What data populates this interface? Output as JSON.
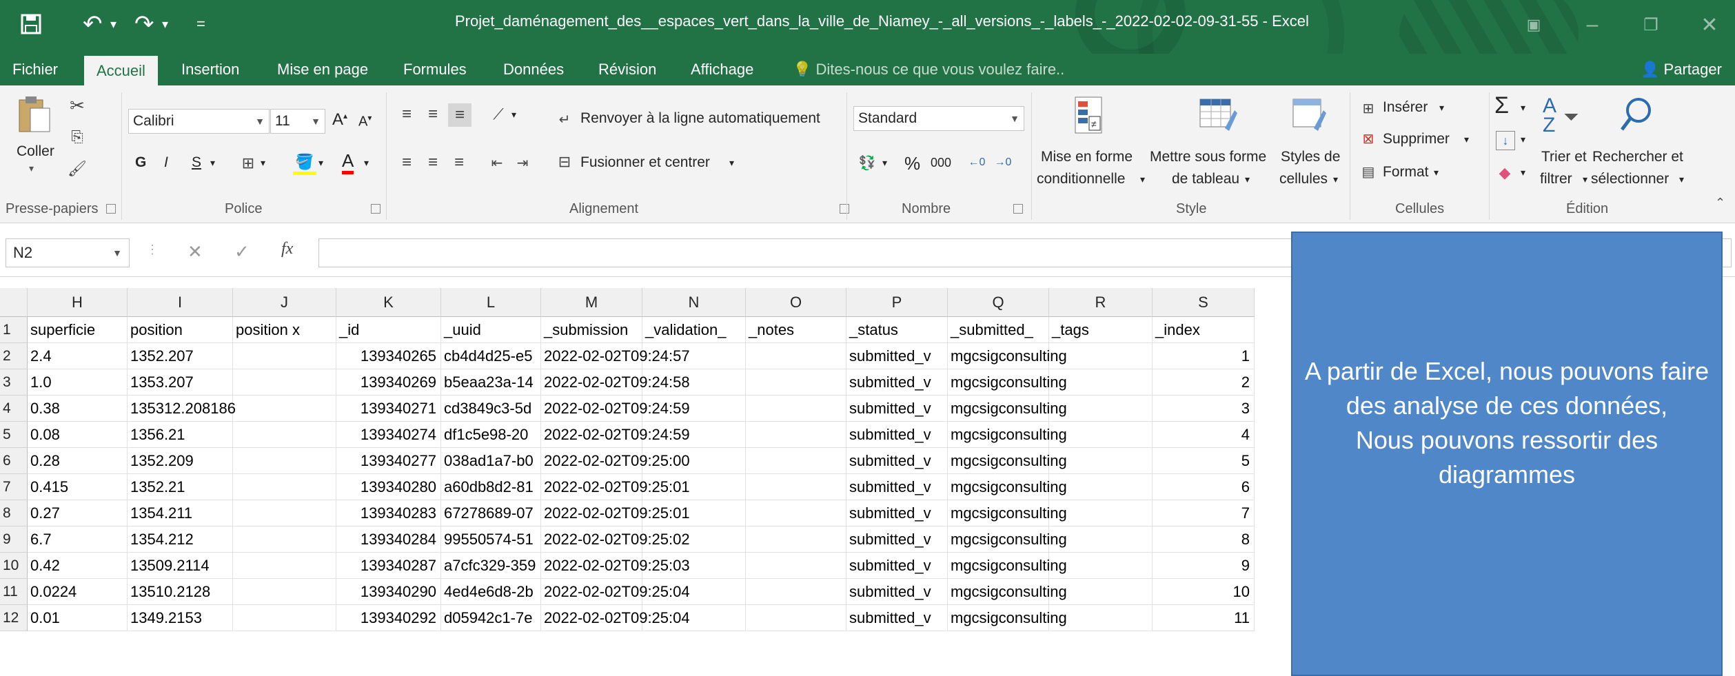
{
  "window": {
    "title": "Projet_daménagement_des__espaces_vert_dans_la_ville_de_Niamey_-_all_versions_-_labels_-_2022-02-02-09-31-55 - Excel"
  },
  "menu": {
    "tabs": [
      "Fichier",
      "Accueil",
      "Insertion",
      "Mise en page",
      "Formules",
      "Données",
      "Révision",
      "Affichage"
    ],
    "tell_me": "Dites-nous ce que vous voulez faire..",
    "share": "Partager"
  },
  "ribbon": {
    "clipboard": {
      "paste": "Coller",
      "label": "Presse-papiers"
    },
    "font": {
      "name": "Calibri",
      "size": "11",
      "bold": "G",
      "italic": "I",
      "underline": "S",
      "label": "Police"
    },
    "alignment": {
      "wrap": "Renvoyer à la ligne automatiquement",
      "merge": "Fusionner et centrer",
      "label": "Alignement"
    },
    "number": {
      "format": "Standard",
      "percent": "%",
      "thousands": "000",
      "label": "Nombre"
    },
    "style": {
      "conditional_1": "Mise en forme",
      "conditional_2": "conditionnelle",
      "table_1": "Mettre sous forme",
      "table_2": "de tableau",
      "cell_1": "Styles de",
      "cell_2": "cellules",
      "label": "Style"
    },
    "cells": {
      "insert": "Insérer",
      "delete": "Supprimer",
      "format": "Format",
      "label": "Cellules"
    },
    "editing": {
      "sort_1": "Trier et",
      "sort_2": "filtrer",
      "find_1": "Rechercher et",
      "find_2": "sélectionner",
      "label": "Édition"
    }
  },
  "formula_bar": {
    "name_box": "N2",
    "fx": "fx"
  },
  "sheet": {
    "columns": [
      "H",
      "I",
      "J",
      "K",
      "L",
      "M",
      "N",
      "O",
      "P",
      "Q",
      "R",
      "S"
    ],
    "header_row": [
      "superficie",
      "position",
      "position x",
      "_id",
      "_uuid",
      "_submission",
      "_validation_",
      "_notes",
      "_status",
      "_submitted_",
      "_tags",
      "_index"
    ],
    "row_numbers": [
      "1",
      "2",
      "3",
      "4",
      "5",
      "6",
      "7",
      "8",
      "9",
      "10",
      "11",
      "12"
    ],
    "rows": [
      {
        "superficie": "2.4",
        "position": "1352.207",
        "id": "139340265",
        "uuid": "cb4d4d25-e5",
        "submission": "2022-02-02T09:24:57",
        "status": "submitted_v",
        "submitted": "mgcsigconsulting",
        "index": "1"
      },
      {
        "superficie": "1.0",
        "position": "1353.207",
        "id": "139340269",
        "uuid": "b5eaa23a-14",
        "submission": "2022-02-02T09:24:58",
        "status": "submitted_v",
        "submitted": "mgcsigconsulting",
        "index": "2"
      },
      {
        "superficie": "0.38",
        "position": "135312.208186",
        "id": "139340271",
        "uuid": "cd3849c3-5d",
        "submission": "2022-02-02T09:24:59",
        "status": "submitted_v",
        "submitted": "mgcsigconsulting",
        "index": "3"
      },
      {
        "superficie": "0.08",
        "position": "1356.21",
        "id": "139340274",
        "uuid": "df1c5e98-20",
        "submission": "2022-02-02T09:24:59",
        "status": "submitted_v",
        "submitted": "mgcsigconsulting",
        "index": "4"
      },
      {
        "superficie": "0.28",
        "position": "1352.209",
        "id": "139340277",
        "uuid": "038ad1a7-b0",
        "submission": "2022-02-02T09:25:00",
        "status": "submitted_v",
        "submitted": "mgcsigconsulting",
        "index": "5"
      },
      {
        "superficie": "0.415",
        "position": "1352.21",
        "id": "139340280",
        "uuid": "a60db8d2-81",
        "submission": "2022-02-02T09:25:01",
        "status": "submitted_v",
        "submitted": "mgcsigconsulting",
        "index": "6"
      },
      {
        "superficie": "0.27",
        "position": "1354.211",
        "id": "139340283",
        "uuid": "67278689-07",
        "submission": "2022-02-02T09:25:01",
        "status": "submitted_v",
        "submitted": "mgcsigconsulting",
        "index": "7"
      },
      {
        "superficie": "6.7",
        "position": "1354.212",
        "id": "139340284",
        "uuid": "99550574-51",
        "submission": "2022-02-02T09:25:02",
        "status": "submitted_v",
        "submitted": "mgcsigconsulting",
        "index": "8"
      },
      {
        "superficie": "0.42",
        "position": "13509.2114",
        "id": "139340287",
        "uuid": "a7cfc329-359",
        "submission": "2022-02-02T09:25:03",
        "status": "submitted_v",
        "submitted": "mgcsigconsulting",
        "index": "9"
      },
      {
        "superficie": "0.0224",
        "position": "13510.2128",
        "id": "139340290",
        "uuid": "4ed4e6d8-2b",
        "submission": "2022-02-02T09:25:04",
        "status": "submitted_v",
        "submitted": "mgcsigconsulting",
        "index": "10"
      },
      {
        "superficie": "0.01",
        "position": "1349.2153",
        "id": "139340292",
        "uuid": "d05942c1-7e",
        "submission": "2022-02-02T09:25:04",
        "status": "submitted_v",
        "submitted": "mgcsigconsulting",
        "index": "11"
      }
    ]
  },
  "callout": {
    "text": "A partir de Excel, nous pouvons faire des analyse de ces données,\nNous pouvons ressortir  des diagrammes"
  },
  "colors": {
    "excel_green": "#217346",
    "callout_blue": "#4f87c9"
  }
}
